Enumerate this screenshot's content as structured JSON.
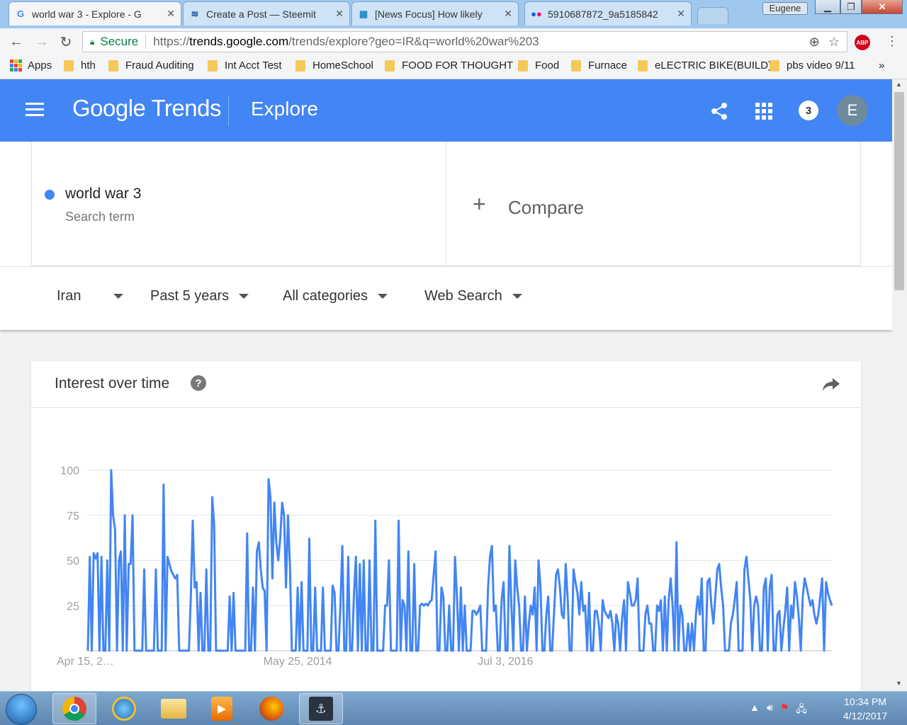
{
  "browser": {
    "tabs": [
      {
        "title": "world war 3 - Explore - G",
        "active": true
      },
      {
        "title": "Create a Post — Steemit",
        "active": false
      },
      {
        "title": "[News Focus] How likely",
        "active": false
      },
      {
        "title": "5910687872_9a5185842",
        "active": false
      }
    ],
    "user": "Eugene",
    "secure_label": "Secure",
    "url_scheme": "https://",
    "url_host": "trends.google.com",
    "url_path": "/trends/explore?geo=IR&q=world%20war%203",
    "bookmarks": [
      "Apps",
      "hth",
      "Fraud Auditing",
      "Int Acct Test",
      "HomeSchool",
      "FOOD FOR THOUGHT",
      "Food",
      "Furnace",
      "eLECTRIC BIKE(BUILD)",
      "pbs video 9/11"
    ],
    "abp_label": "ABP"
  },
  "header": {
    "logo": "Google Trends",
    "section": "Explore",
    "notifications": "3",
    "avatar_letter": "E",
    "color": "#4285f4"
  },
  "search": {
    "term": "world war 3",
    "term_label": "Search term",
    "compare_label": "Compare",
    "filters": {
      "region": "Iran",
      "time": "Past 5 years",
      "category": "All categories",
      "property": "Web Search"
    }
  },
  "interest": {
    "title": "Interest over time",
    "help": "?"
  },
  "chart_data": {
    "type": "line",
    "yticks": [
      100,
      75,
      50,
      25
    ],
    "ylim": [
      0,
      100
    ],
    "xtick_labels": [
      "Apr 15, 2…",
      "May 25, 2014",
      "Jul 3, 2016"
    ],
    "xtick_index": [
      0,
      108,
      215
    ],
    "series": [
      {
        "color": "#4285f4",
        "values": [
          0,
          52,
          0,
          54,
          51,
          54,
          0,
          52,
          0,
          0,
          50,
          0,
          100,
          75,
          67,
          0,
          50,
          55,
          0,
          75,
          0,
          48,
          48,
          75,
          0,
          0,
          0,
          0,
          0,
          45,
          0,
          0,
          0,
          0,
          0,
          45,
          0,
          0,
          0,
          92,
          0,
          52,
          48,
          44,
          42,
          40,
          42,
          0,
          0,
          0,
          0,
          0,
          0,
          30,
          72,
          35,
          38,
          0,
          32,
          0,
          0,
          45,
          0,
          0,
          85,
          70,
          0,
          0,
          0,
          0,
          0,
          0,
          0,
          30,
          0,
          32,
          0,
          0,
          0,
          0,
          0,
          0,
          65,
          0,
          0,
          35,
          0,
          55,
          60,
          45,
          35,
          33,
          0,
          95,
          85,
          40,
          82,
          60,
          50,
          62,
          82,
          75,
          35,
          75,
          48,
          0,
          0,
          0,
          35,
          0,
          38,
          0,
          0,
          0,
          62,
          0,
          0,
          35,
          0,
          0,
          0,
          35,
          0,
          0,
          0,
          0,
          36,
          32,
          0,
          0,
          25,
          58,
          0,
          0,
          52,
          0,
          0,
          32,
          52,
          0,
          48,
          0,
          50,
          0,
          0,
          50,
          0,
          0,
          72,
          0,
          0,
          0,
          0,
          25,
          25,
          50,
          0,
          0,
          0,
          0,
          72,
          0,
          28,
          25,
          0,
          55,
          0,
          0,
          48,
          0,
          0,
          25,
          26,
          25,
          26,
          25,
          27,
          28,
          42,
          55,
          0,
          0,
          35,
          30,
          0,
          0,
          25,
          0,
          0,
          52,
          30,
          0,
          35,
          0,
          25,
          0,
          0,
          0,
          22,
          22,
          20,
          22,
          25,
          0,
          0,
          0,
          35,
          52,
          58,
          22,
          25,
          0,
          0,
          28,
          38,
          0,
          0,
          58,
          25,
          0,
          50,
          35,
          25,
          0,
          0,
          30,
          0,
          15,
          25,
          20,
          35,
          0,
          50,
          35,
          0,
          0,
          20,
          30,
          0,
          0,
          22,
          42,
          45,
          35,
          20,
          18,
          48,
          28,
          0,
          0,
          45,
          38,
          32,
          20,
          38,
          22,
          25,
          0,
          32,
          0,
          0,
          22,
          22,
          15,
          0,
          28,
          22,
          20,
          18,
          22,
          15,
          0,
          20,
          15,
          0,
          18,
          28,
          0,
          38,
          32,
          25,
          25,
          28,
          40,
          0,
          0,
          0,
          20,
          25,
          15,
          15,
          0,
          0,
          25,
          22,
          28,
          0,
          30,
          0,
          28,
          40,
          25,
          0,
          60,
          0,
          25,
          20,
          0,
          0,
          15,
          0,
          15,
          0,
          20,
          30,
          20,
          40,
          0,
          0,
          38,
          40,
          25,
          15,
          30,
          45,
          48,
          35,
          25,
          0,
          0,
          0,
          15,
          20,
          28,
          38,
          0,
          0,
          0,
          45,
          52,
          40,
          28,
          0,
          25,
          30,
          25,
          0,
          0,
          35,
          40,
          0,
          35,
          42,
          0,
          0,
          20,
          22,
          0,
          12,
          22,
          35,
          0,
          25,
          18,
          38,
          30,
          18,
          0,
          30,
          40,
          35,
          30,
          25,
          28,
          20,
          15,
          20,
          30,
          40,
          0,
          38,
          32,
          28,
          25
        ]
      }
    ]
  },
  "taskbar": {
    "time": "10:34 PM",
    "date": "4/12/2017"
  }
}
